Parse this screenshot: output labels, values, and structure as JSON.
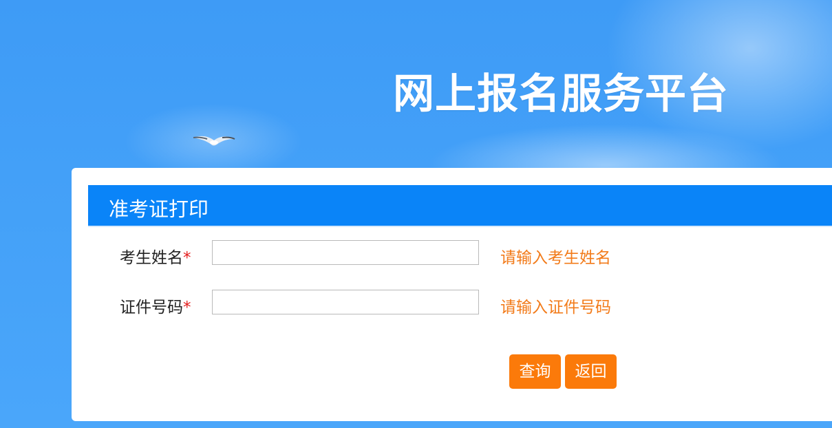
{
  "site": {
    "title": "网上报名服务平台"
  },
  "panel": {
    "title": "准考证打印"
  },
  "form": {
    "fields": [
      {
        "label": "考生姓名",
        "required_mark": "*",
        "value": "",
        "hint": "请输入考生姓名"
      },
      {
        "label": "证件号码",
        "required_mark": "*",
        "value": "",
        "hint": "请输入证件号码"
      }
    ],
    "query_label": "查询",
    "back_label": "返回"
  },
  "colors": {
    "background": "#43a0f8",
    "header_bar": "#0a84f8",
    "button": "#fb7a0a",
    "hint_text": "#f27b1a",
    "required_mark": "#e31b1b"
  }
}
